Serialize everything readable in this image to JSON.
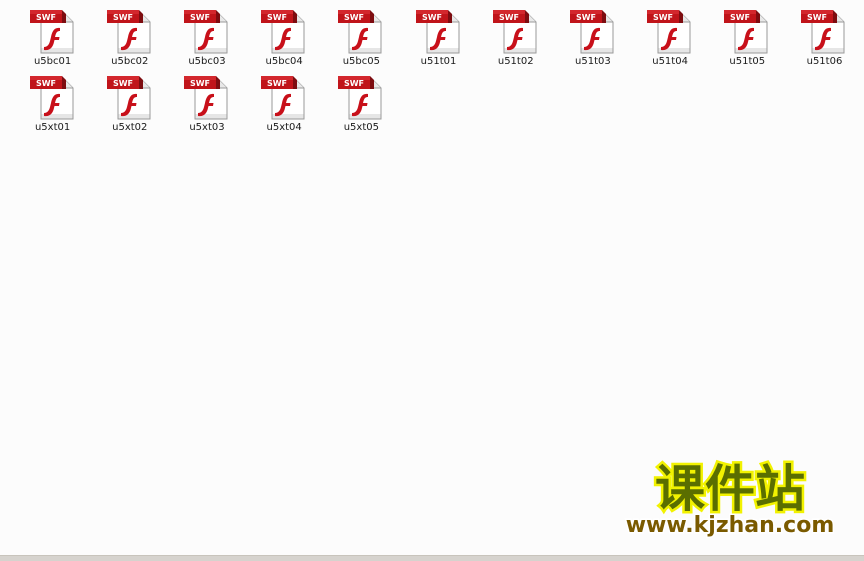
{
  "files": [
    {
      "name": "u5bc01",
      "badge": "SWF"
    },
    {
      "name": "u5bc02",
      "badge": "SWF"
    },
    {
      "name": "u5bc03",
      "badge": "SWF"
    },
    {
      "name": "u5bc04",
      "badge": "SWF"
    },
    {
      "name": "u5bc05",
      "badge": "SWF"
    },
    {
      "name": "u51t01",
      "badge": "SWF"
    },
    {
      "name": "u51t02",
      "badge": "SWF"
    },
    {
      "name": "u51t03",
      "badge": "SWF"
    },
    {
      "name": "u51t04",
      "badge": "SWF"
    },
    {
      "name": "u51t05",
      "badge": "SWF"
    },
    {
      "name": "u51t06",
      "badge": "SWF"
    },
    {
      "name": "u5xt01",
      "badge": "SWF"
    },
    {
      "name": "u5xt02",
      "badge": "SWF"
    },
    {
      "name": "u5xt03",
      "badge": "SWF"
    },
    {
      "name": "u5xt04",
      "badge": "SWF"
    },
    {
      "name": "u5xt05",
      "badge": "SWF"
    }
  ],
  "file_icon": "swf-file-icon",
  "watermark": {
    "title": "课件站",
    "url": "www.kjzhan.com"
  },
  "colors": {
    "badge_red": "#c0141a",
    "flash_red": "#c8101a",
    "watermark_fill": "#5a6e00",
    "watermark_outline": "#f2f200",
    "url_text": "#7a5a00"
  }
}
